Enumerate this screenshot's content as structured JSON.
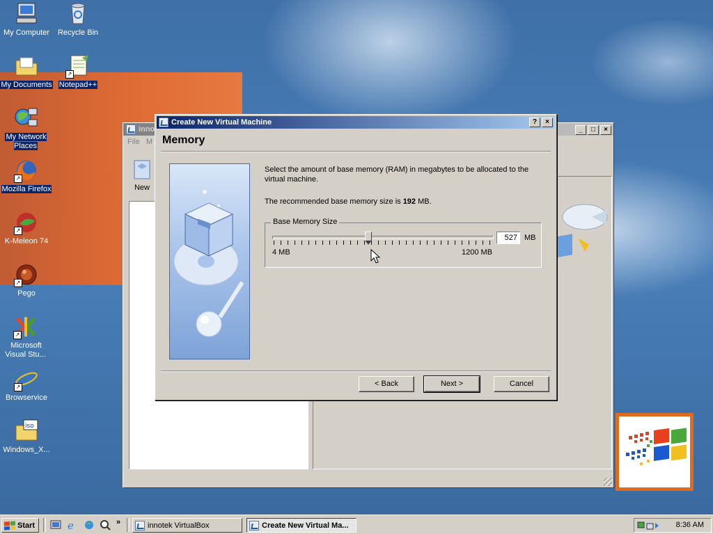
{
  "desktop": {
    "icons": [
      {
        "id": "my-computer",
        "label": "My Computer",
        "icon": "computer-icon",
        "selected": false
      },
      {
        "id": "recycle-bin",
        "label": "Recycle Bin",
        "icon": "recycle-bin-icon",
        "selected": false
      },
      {
        "id": "my-documents",
        "label": "My Documents",
        "icon": "folder-icon",
        "selected": true
      },
      {
        "id": "notepadpp",
        "label": "Notepad++",
        "icon": "notepad-icon",
        "selected": true
      },
      {
        "id": "my-network-places",
        "label": "My Network Places",
        "icon": "network-icon",
        "selected": true
      },
      {
        "id": "mozilla-firefox",
        "label": "Mozilla Firefox",
        "icon": "firefox-icon",
        "selected": true
      },
      {
        "id": "k-meleon",
        "label": "K-Meleon 74",
        "icon": "k-meleon-icon",
        "selected": false
      },
      {
        "id": "pego",
        "label": "Pego",
        "icon": "pego-icon",
        "selected": false
      },
      {
        "id": "ms-visual-studio",
        "label": "Microsoft Visual Stu...",
        "icon": "visual-studio-icon",
        "selected": false
      },
      {
        "id": "browservice",
        "label": "Browservice",
        "icon": "ie-icon",
        "selected": false
      },
      {
        "id": "windows-iso",
        "label": "Windows_X...",
        "icon": "iso-file-icon",
        "selected": false
      }
    ]
  },
  "background_window": {
    "title": "innot",
    "menu": [
      "File",
      "M"
    ],
    "new_label": "New"
  },
  "dialog": {
    "title": "Create New Virtual Machine",
    "help_btn": "?",
    "close_btn": "×",
    "heading": "Memory",
    "description": "Select the amount of base memory (RAM) in megabytes to be allocated to the virtual machine.",
    "recommend_prefix": "The recommended base memory size is ",
    "recommend_value": "192",
    "recommend_suffix": " MB.",
    "group_title": "Base Memory Size",
    "memory_value": "527",
    "unit": "MB",
    "min_label": "4 MB",
    "max_label": "1200 MB",
    "slider_min": 4,
    "slider_max": 1200,
    "slider_value": 527,
    "buttons": {
      "back": "< Back",
      "next": "Next >",
      "cancel": "Cancel"
    }
  },
  "taskbar": {
    "start_label": "Start",
    "quicklaunch": [
      "desktop-icon",
      "ie-icon",
      "network-icon",
      "search-icon"
    ],
    "chevron": "»",
    "tasks": [
      {
        "label": "innotek VirtualBox",
        "active": false
      },
      {
        "label": "Create New Virtual Ma...",
        "active": true
      }
    ],
    "clock": "8:36 AM"
  },
  "colors": {
    "accent": "#0a246a",
    "desktop": "#3b6ea5",
    "face": "#d4d0c8"
  }
}
